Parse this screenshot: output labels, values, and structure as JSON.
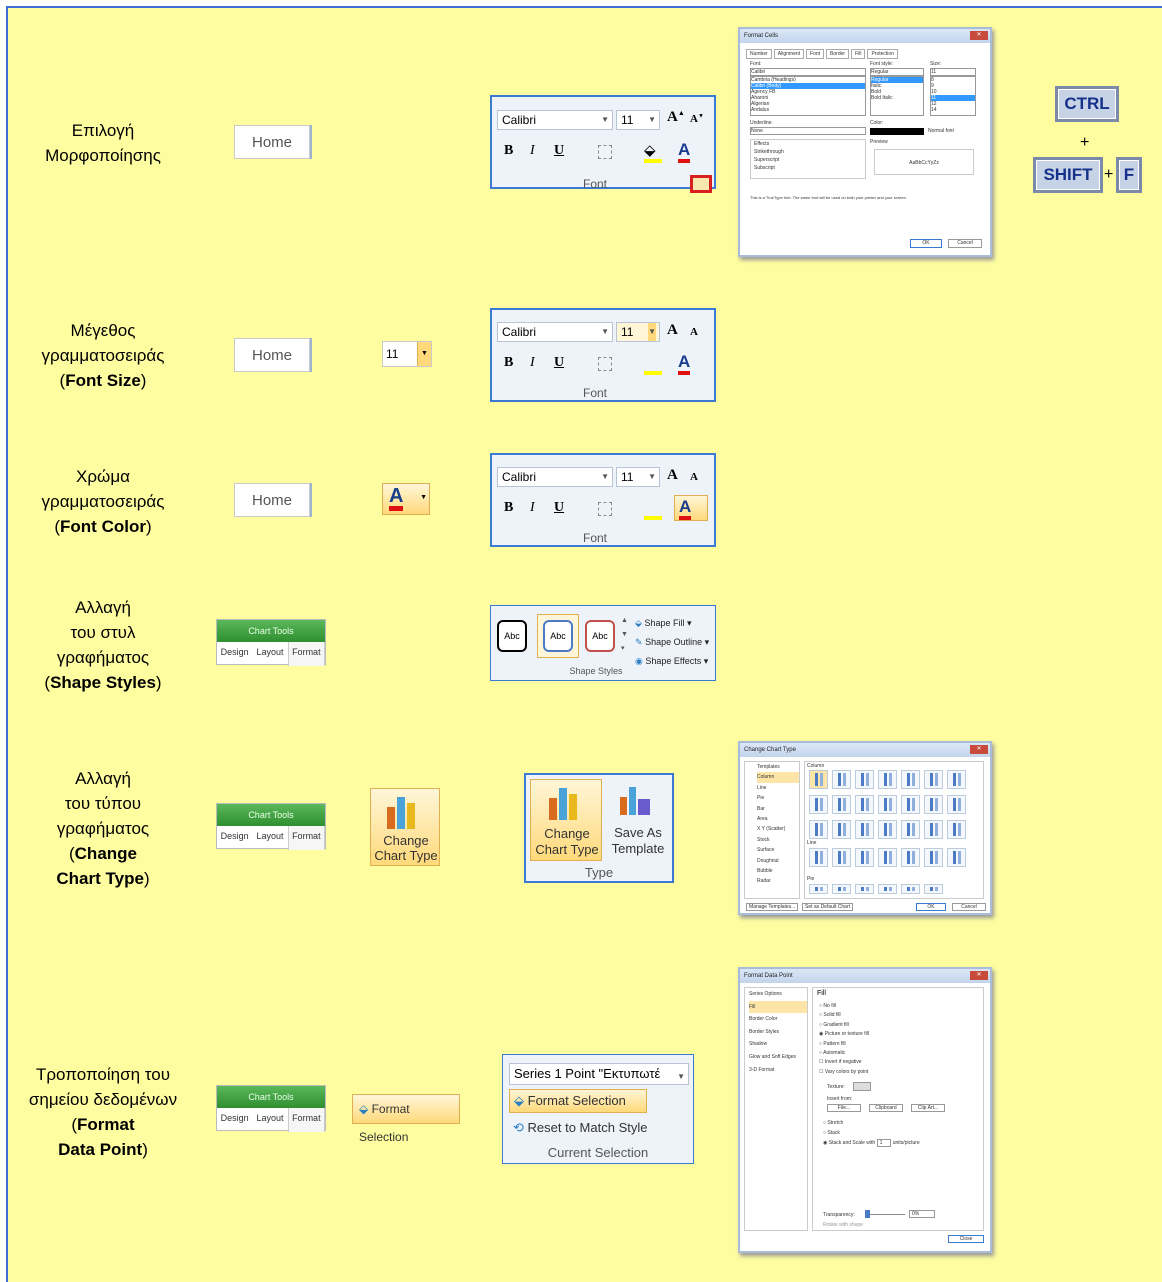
{
  "rows": [
    {
      "lines": [
        "Επιλογή",
        "Μορφοποίησης"
      ],
      "bold": "",
      "after": ""
    },
    {
      "lines": [
        "Μέγεθος",
        "γραμματοσειράς"
      ],
      "bold": "Font Size"
    },
    {
      "lines": [
        "Χρώμα",
        "γραμματοσειράς"
      ],
      "bold": "Font Color"
    },
    {
      "lines": [
        "Αλλαγή",
        "του στυλ",
        "γραφήματος"
      ],
      "bold": "Shape Styles"
    },
    {
      "lines": [
        "Αλλαγή",
        "του τύπου",
        "γραφήματος"
      ],
      "bold1": "Change",
      "bold2": "Chart Type"
    },
    {
      "lines": [
        "Τροποποίηση του",
        "σημείου δεδομένων"
      ],
      "bold1": "Format",
      "bold2": "Data Point"
    }
  ],
  "home_tab": "Home",
  "font_ribbon": {
    "font": "Calibri",
    "size": "11",
    "bold": "B",
    "italic": "I",
    "underline": "U",
    "grow": "A",
    "shrink": "A",
    "font_color": "A",
    "group": "Font"
  },
  "size_combo": "11",
  "chart_tools": {
    "title": "Chart Tools",
    "tabs": [
      "Design",
      "Layout",
      "Format"
    ]
  },
  "shape_styles": {
    "abc": "Abc",
    "fill": "Shape Fill",
    "outline": "Shape Outline",
    "effects": "Shape Effects",
    "group": "Shape Styles"
  },
  "change_chart_button": {
    "line1": "Change",
    "line2": "Chart Type"
  },
  "type_group": {
    "change1": "Change",
    "change2": "Chart Type",
    "save1": "Save As",
    "save2": "Template",
    "group": "Type"
  },
  "format_selection_button": "Format Selection",
  "current_selection": {
    "combo": "Series 1 Point \"Εκτυπωτέ",
    "format": "Format Selection",
    "reset": "Reset to Match Style",
    "group": "Current Selection"
  },
  "shortcut": {
    "ctrl": "CTRL",
    "plus1": "+",
    "shift": "SHIFT",
    "plus2": "+",
    "f": "F"
  },
  "format_cells": {
    "title": "Format Cells",
    "tabs": [
      "Number",
      "Alignment",
      "Font",
      "Border",
      "Fill",
      "Protection"
    ],
    "font_label": "Font:",
    "font_value": "Calibri",
    "fonts": [
      "Cambria (Headings)",
      "Calibri (Body)",
      "Agency FB",
      "Aharoni",
      "Algerian",
      "Andalus"
    ],
    "style_label": "Font style:",
    "style_value": "Regular",
    "styles": [
      "Regular",
      "Italic",
      "Bold",
      "Bold Italic"
    ],
    "size_label": "Size:",
    "size_value": "11",
    "sizes": [
      "8",
      "9",
      "10",
      "11",
      "12",
      "14"
    ],
    "underline_label": "Underline:",
    "underline_value": "None",
    "color_label": "Color:",
    "normal_font": "Normal font",
    "effects_label": "Effects",
    "effects": [
      "Strikethrough",
      "Superscript",
      "Subscript"
    ],
    "preview_label": "Preview",
    "preview_text": "AaBbCcYyZz",
    "note": "This is a TrueType font. The same font will be used on both your printer and your screen.",
    "ok": "OK",
    "cancel": "Cancel"
  },
  "change_chart_type": {
    "title": "Change Chart Type",
    "categories": [
      "Templates",
      "Column",
      "Line",
      "Pie",
      "Bar",
      "Area",
      "X Y (Scatter)",
      "Stock",
      "Surface",
      "Doughnut",
      "Bubble",
      "Radar"
    ],
    "sections": [
      "Column",
      "Line",
      "Pie"
    ],
    "manage": "Manage Templates...",
    "default": "Set as Default Chart",
    "ok": "OK",
    "cancel": "Cancel"
  },
  "format_data_point": {
    "title": "Format Data Point",
    "nav": [
      "Series Options",
      "Fill",
      "Border Color",
      "Border Styles",
      "Shadow",
      "Glow and Soft Edges",
      "3-D Format"
    ],
    "heading": "Fill",
    "options": [
      "No fill",
      "Solid fill",
      "Gradient fill",
      "Picture or texture fill",
      "Pattern fill",
      "Automatic"
    ],
    "checks": [
      "Invert if negative",
      "Vary colors by point"
    ],
    "texture": "Texture:",
    "insert_from": "Insert from:",
    "file": "File...",
    "clipboard": "Clipboard",
    "clipart": "Clip Art...",
    "stretch": "Stretch",
    "stack": "Stack",
    "stack_scale": "Stack and Scale with",
    "units": "units/picture",
    "units_value": "1",
    "transparency": "Transparency:",
    "transparency_value": "0%",
    "rotate": "Rotate with shape",
    "close": "Close"
  }
}
